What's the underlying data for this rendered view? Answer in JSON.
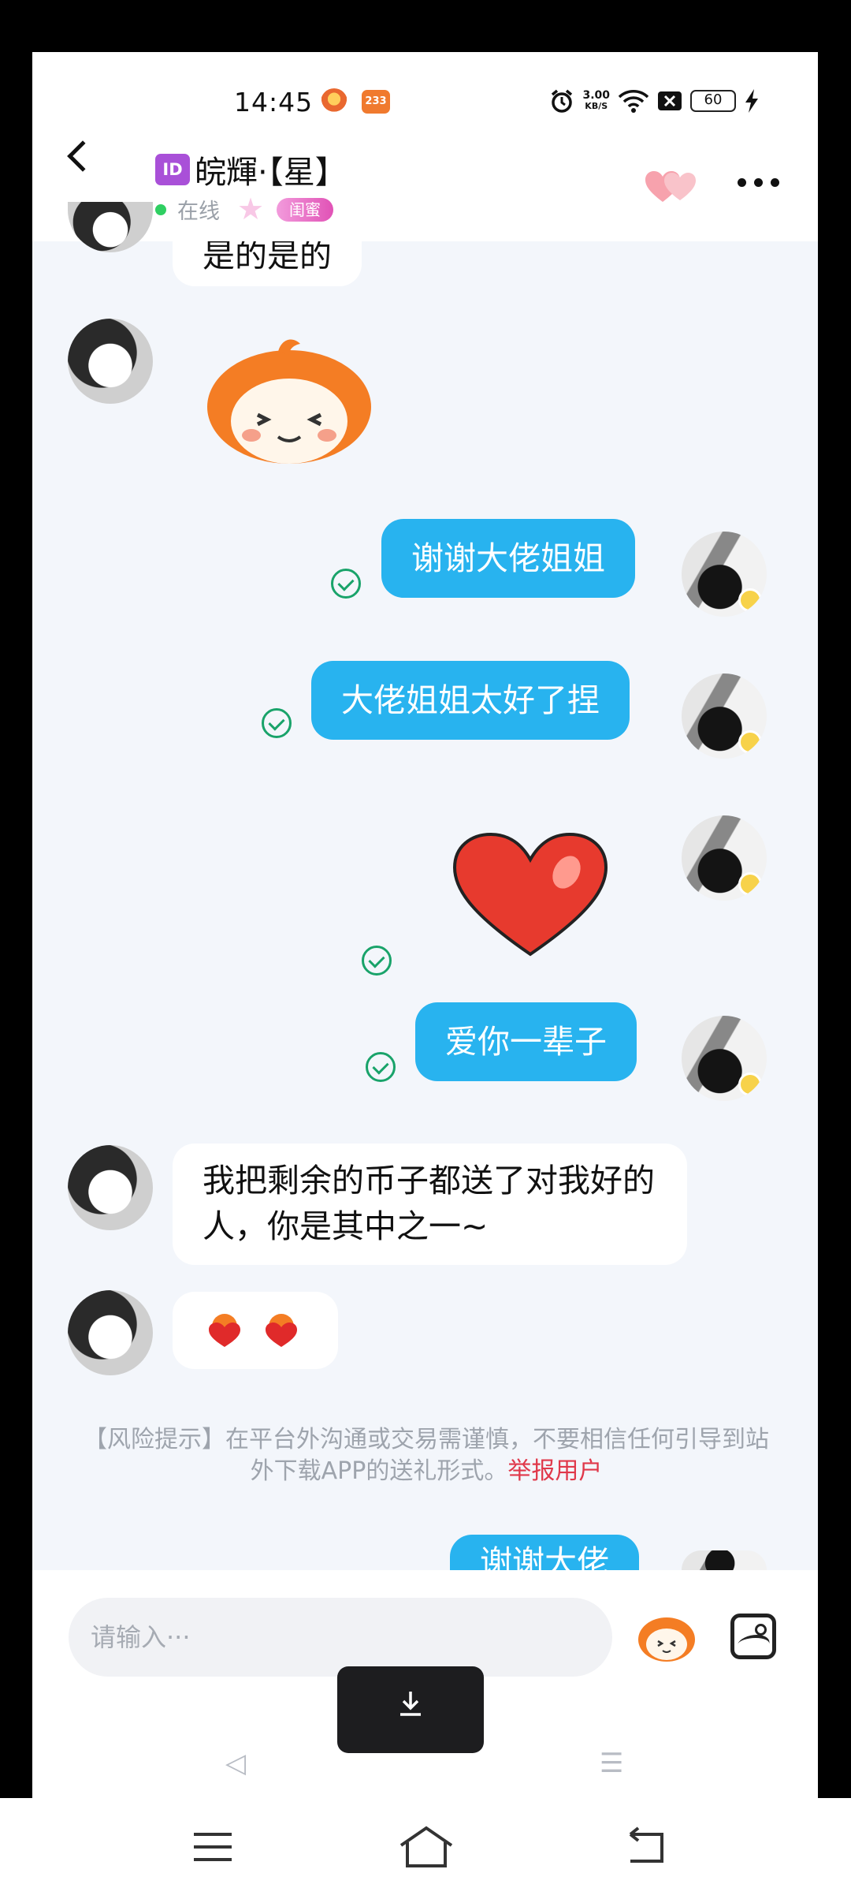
{
  "status_bar": {
    "time": "14:45",
    "app_badge": "233",
    "net_speed_value": "3.00",
    "net_speed_unit": "KB/S",
    "battery": "60"
  },
  "header": {
    "id_badge": "ID",
    "contact_name": "皖輝·【星】",
    "online_status": "在线",
    "relationship_tag": "闺蜜"
  },
  "messages": {
    "m1_text": "是的是的",
    "m3_text": "谢谢大佬姐姐",
    "m4_text": "大佬姐姐太好了捏",
    "m6_text": "爱你一辈子",
    "m7_text": "我把剩余的币子都送了对我好的人，你是其中之一~",
    "m9_text": "谢谢大佬"
  },
  "risk_notice": {
    "text": "【风险提示】在平台外沟通或交易需谨慎，不要相信任何引导到站外下载APP的送礼形式。",
    "report_link": "举报用户"
  },
  "input_bar": {
    "placeholder": "请输入···"
  },
  "colors": {
    "outgoing_bubble": "#28b3ef",
    "incoming_bubble": "#ffffff",
    "report_link": "#e0384a",
    "online_dot": "#2fcf62",
    "read_check": "#19a36a"
  },
  "icons": [
    "back-arrow-icon",
    "hearts-icon",
    "more-icon",
    "sticker-emoji-icon",
    "image-icon",
    "download-icon",
    "alarm-icon",
    "wifi-icon",
    "battery-icon"
  ]
}
